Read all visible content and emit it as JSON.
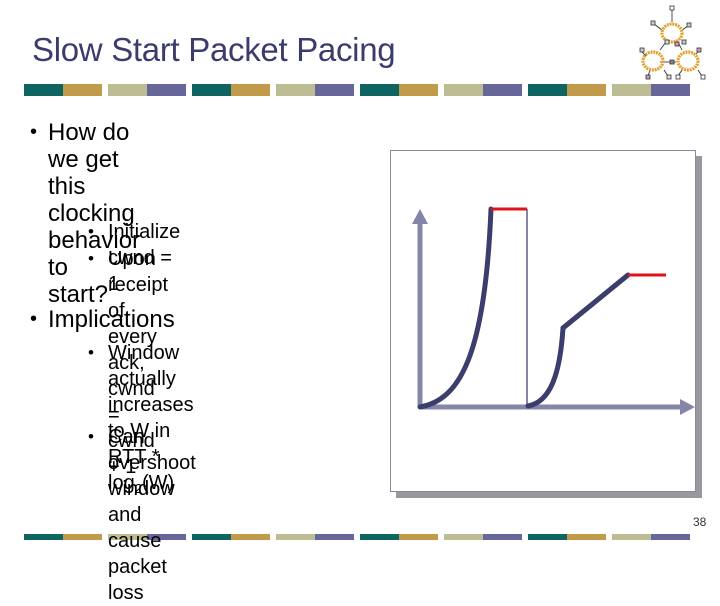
{
  "slide": {
    "title": "Slow Start Packet Pacing",
    "page_number": "38"
  },
  "theme": {
    "title_color": "#3b3b6e",
    "bar_colors": [
      "#0e6461",
      "#c29b4a",
      "#bcbd92",
      "#66669a"
    ],
    "axis_color": "#8585a8",
    "curve_color": "#3b3d6c",
    "limit_color": "#e0121b",
    "frame_shadow_color": "#99989f"
  },
  "bullets": [
    {
      "text": "How do we get this clocking behavior to start?",
      "lines": [
        "How do we get this",
        "clocking behavior to",
        "start?"
      ],
      "sub": [
        {
          "lines": [
            "Initialize cwnd = 1"
          ]
        },
        {
          "lines": [
            "Upon receipt of every",
            "ack, cwnd = cwnd + 1"
          ]
        }
      ]
    },
    {
      "text": "Implications",
      "lines": [
        "Implications"
      ],
      "sub": [
        {
          "lines": [
            "Window actually",
            "increases to W in RTT *"
          ],
          "tail_prefix": "log",
          "tail_sub": "2",
          "tail_suffix": "(W)"
        },
        {
          "lines": [
            "Can overshoot window",
            "and cause packet loss"
          ]
        }
      ]
    }
  ],
  "diagram": {
    "description": "cwnd vs time: exponential slow start growth overshooting to a limit (red), then drop and restart with slow start followed by linear congestion avoidance to a lower limit (red)",
    "axes": {
      "x_arrow": true,
      "y_arrow": true
    },
    "phases": [
      {
        "name": "slow-start-overshoot",
        "type": "exponential"
      },
      {
        "name": "loss-drop",
        "type": "vertical"
      },
      {
        "name": "slow-start-restart",
        "type": "exponential"
      },
      {
        "name": "congestion-avoidance",
        "type": "linear"
      }
    ]
  }
}
